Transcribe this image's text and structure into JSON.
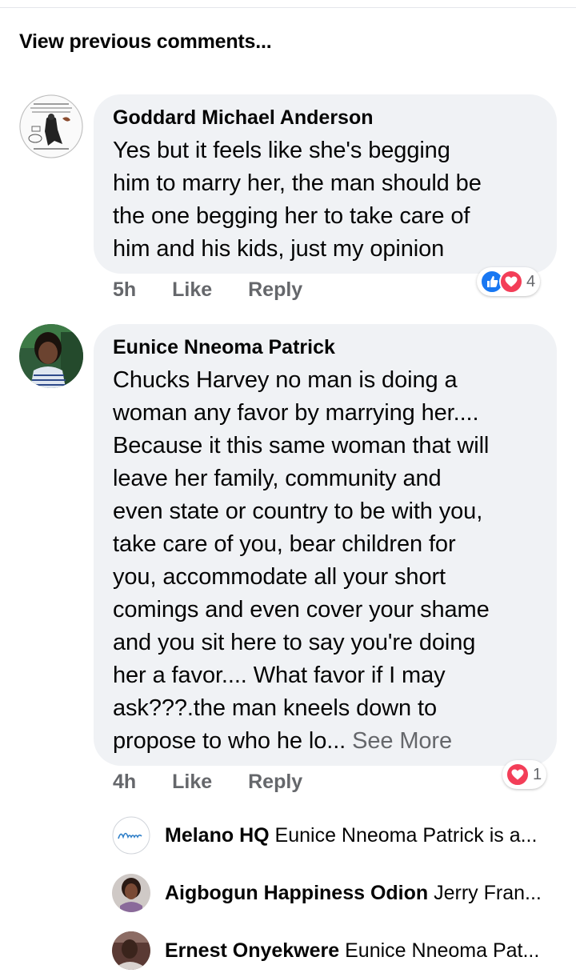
{
  "view_previous": "View previous comments...",
  "comments": [
    {
      "author": "Goddard Michael Anderson",
      "text": "Yes but it feels like she's begging\nhim to marry her, the man should be\nthe one begging her to take care of\nhim and his kids, just my opinion",
      "time": "5h",
      "like": "Like",
      "reply": "Reply",
      "reaction_count": "4",
      "reactions": [
        "like-icon",
        "love-icon"
      ]
    },
    {
      "author": "Eunice Nneoma Patrick",
      "text": "Chucks Harvey no man is doing a\nwoman any favor by marrying her....\nBecause it this same woman that will\nleave her family, community and\neven state or country to be with you,\ntake care of you, bear children for\nyou, accommodate all your short\ncomings and even cover your shame\nand you sit here to say you're doing\nher a favor.... What favor if I may\nask???.the man kneels down to\npropose to who he lo... ",
      "see_more": "See More",
      "time": "4h",
      "like": "Like",
      "reply": "Reply",
      "reaction_count": "1",
      "reactions": [
        "love-icon"
      ]
    }
  ],
  "replies": [
    {
      "name": "Melano HQ",
      "snippet": "Eunice Nneoma Patrick is a..."
    },
    {
      "name": "Aigbogun Happiness Odion",
      "snippet": "Jerry Fran..."
    },
    {
      "name": "Ernest Onyekwere",
      "snippet": "Eunice Nneoma Pat..."
    }
  ],
  "colors": {
    "bubble": "#f0f2f5",
    "meta_text": "#65676b",
    "like_blue": "#1877f2",
    "love_red": "#f33e58"
  }
}
